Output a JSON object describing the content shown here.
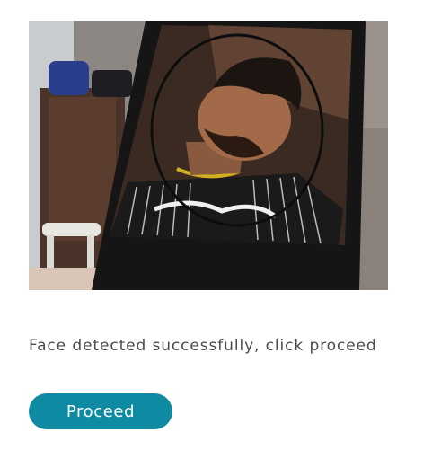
{
  "camera_preview": {
    "face_detected": true
  },
  "status": {
    "message": "Face detected successfully, click proceed"
  },
  "actions": {
    "proceed_label": "Proceed"
  },
  "colors": {
    "accent": "#0f8aa3",
    "face_guide_outline": "#0d0d0d",
    "status_text": "#4a4a4a"
  },
  "icons": {
    "face_guide": "face-guide-oval-icon"
  }
}
